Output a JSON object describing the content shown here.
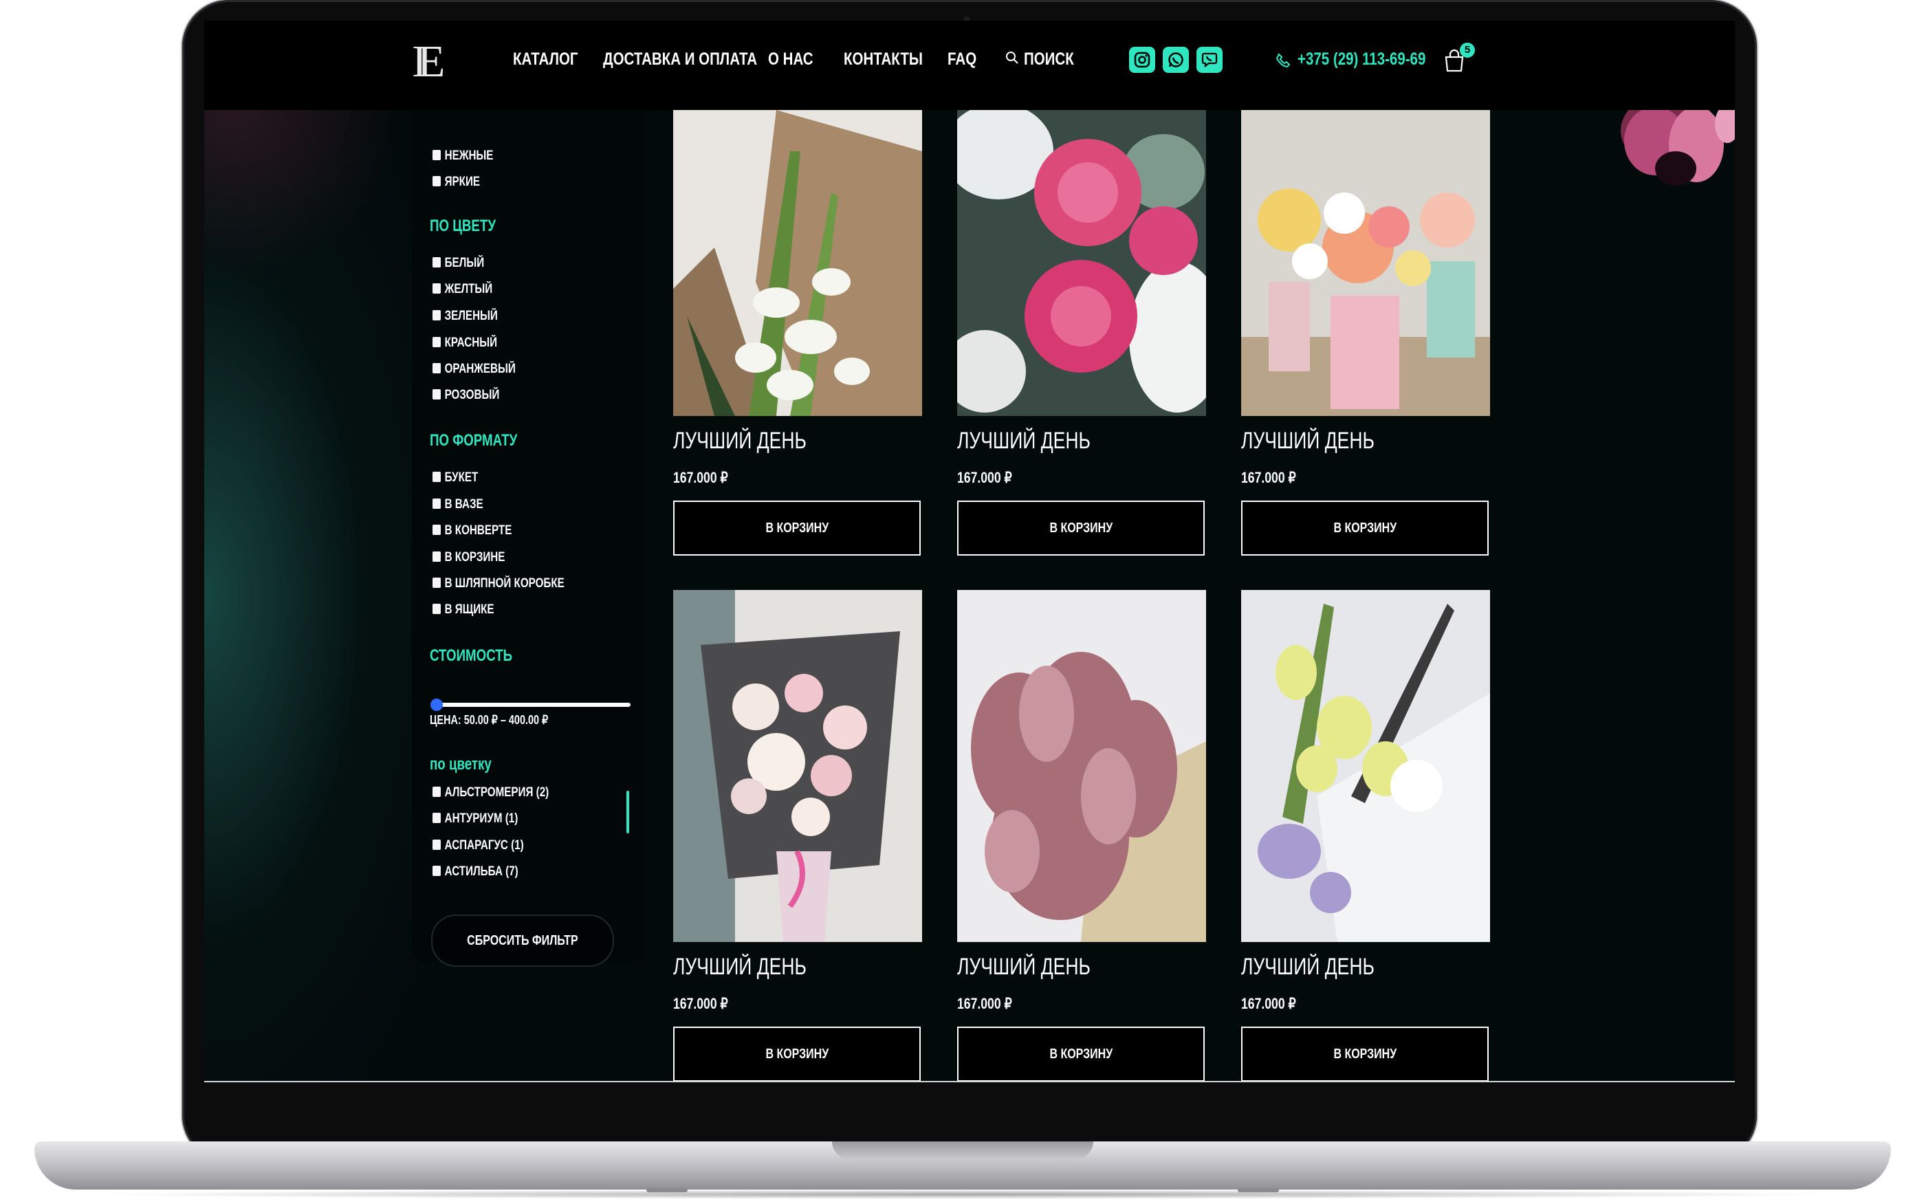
{
  "header": {
    "logo": "IE",
    "nav": [
      "КАТАЛОГ",
      "ДОСТАВКА И ОПЛАТА",
      "О НАС",
      "КОНТАКТЫ",
      "FAQ"
    ],
    "search_label": "ПОИСК",
    "phone": "+375 (29) 113-69-69",
    "cart_count": "5",
    "social_icons": [
      "instagram-icon",
      "whatsapp-icon",
      "viber-icon"
    ],
    "accent_color": "#2ee6c0"
  },
  "sidebar": {
    "mood_items": [
      "НЕЖНЫЕ",
      "ЯРКИЕ"
    ],
    "color_heading": "ПО ЦВЕТУ",
    "color_items": [
      "БЕЛЫЙ",
      "ЖЕЛТЫЙ",
      "ЗЕЛЕНЫЙ",
      "КРАСНЫЙ",
      "ОРАНЖЕВЫЙ",
      "РОЗОВЫЙ"
    ],
    "format_heading": "ПО ФОРМАТУ",
    "format_items": [
      "БУКЕТ",
      "В ВАЗЕ",
      "В КОНВЕРТЕ",
      "В КОРЗИНЕ",
      "В ШЛЯПНОЙ КОРОБКЕ",
      "В ЯЩИКЕ"
    ],
    "price_heading": "СТОИМОСТЬ",
    "price_range": "ЦЕНА: 50.00 ₽ – 400.00 ₽",
    "price_slider_position": 0,
    "flower_heading": "по цветку",
    "flower_items": [
      "АЛЬСТРОМЕРИЯ (2)",
      "АНТУРИУМ (1)",
      "АСПАРАГУС (1)",
      "АСТИЛЬБА (7)"
    ],
    "reset_label": "СБРОСИТЬ ФИЛЬТР"
  },
  "products": [
    {
      "title": "ЛУЧШИЙ ДЕНЬ",
      "price": "167.000 ₽",
      "button": "В КОРЗИНУ"
    },
    {
      "title": "ЛУЧШИЙ ДЕНЬ",
      "price": "167.000 ₽",
      "button": "В КОРЗИНУ"
    },
    {
      "title": "ЛУЧШИЙ ДЕНЬ",
      "price": "167.000 ₽",
      "button": "В КОРЗИНУ"
    },
    {
      "title": "ЛУЧШИЙ ДЕНЬ",
      "price": "167.000 ₽",
      "button": "В КОРЗИНУ"
    },
    {
      "title": "ЛУЧШИЙ ДЕНЬ",
      "price": "167.000 ₽",
      "button": "В КОРЗИНУ"
    },
    {
      "title": "ЛУЧШИЙ ДЕНЬ",
      "price": "167.000 ₽",
      "button": "В КОРЗИНУ"
    }
  ]
}
